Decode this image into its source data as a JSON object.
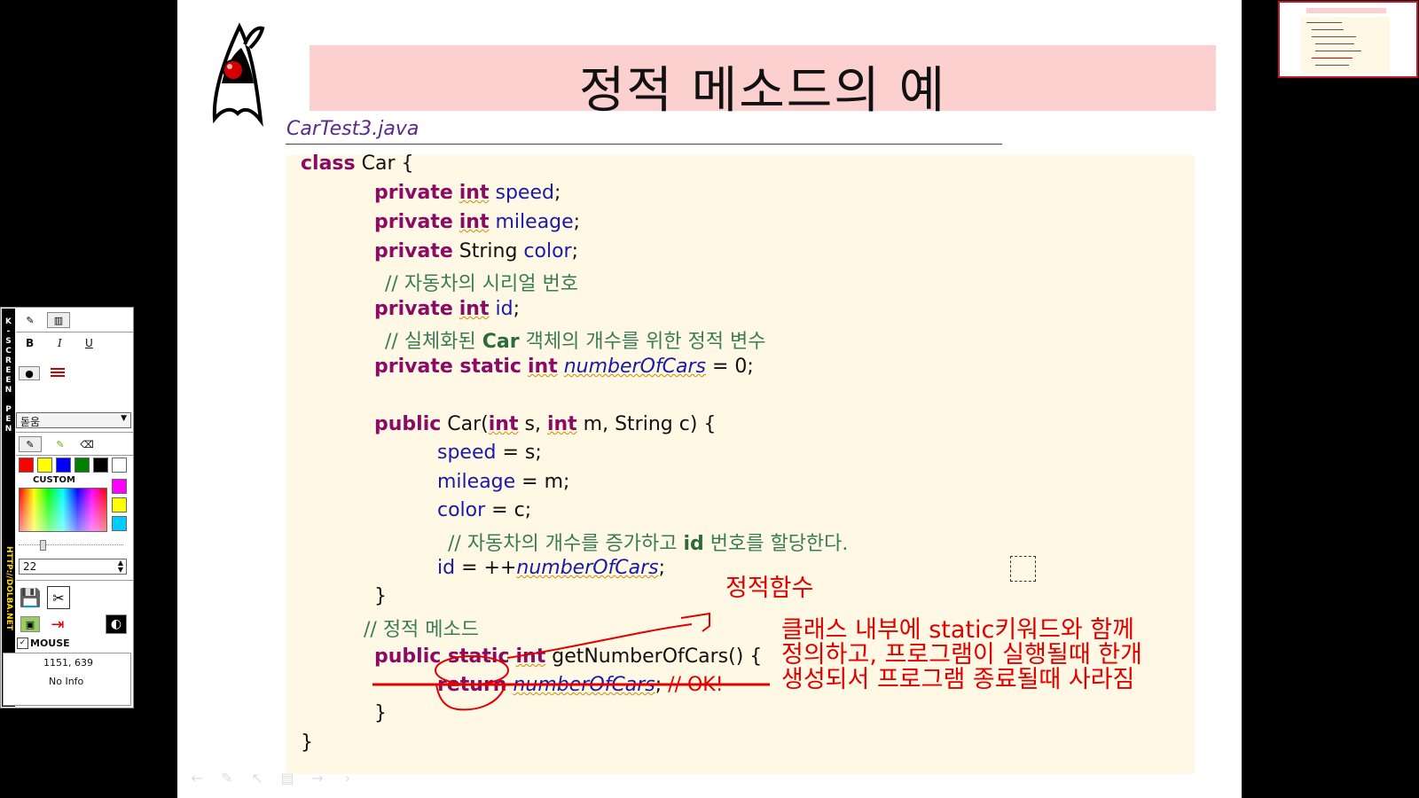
{
  "slide": {
    "title": "정적 메소드의 예",
    "filename": "CarTest3.java",
    "code": {
      "l1": {
        "kw": "class",
        "name": " Car {"
      },
      "l2": {
        "kw": "private",
        "type": "int",
        "var": "speed",
        "end": ";"
      },
      "l3": {
        "kw": "private",
        "type": "int",
        "var": "mileage",
        "end": ";"
      },
      "l4": {
        "kw": "private",
        "type": "String",
        "var": "color",
        "end": ";"
      },
      "l5": {
        "comment": "// 자동차의 시리얼 번호"
      },
      "l6": {
        "kw": "private",
        "type": "int",
        "var": "id",
        "end": ";"
      },
      "l7": {
        "c1": "// 실체화된 ",
        "c2": "Car",
        "c3": " 객체의 개수를 위한 정적 변수"
      },
      "l8": {
        "kw": "private static",
        "type": "int",
        "var": "numberOfCars",
        "end": " = 0;"
      },
      "l9": {
        "kw": "public",
        "a": " Car(",
        "t1": "int",
        "b": " s, ",
        "t2": "int",
        "c": " m, String c) {"
      },
      "l10": {
        "var": "speed",
        "end": " = s;"
      },
      "l11": {
        "var": "mileage",
        "end": " = m;"
      },
      "l12": {
        "var": "color",
        "end": " = c;"
      },
      "l13": {
        "c1": "// 자동차의 개수를 증가하고 ",
        "c2": "id",
        "c3": " 번호를 할당한다."
      },
      "l14": {
        "var": "id",
        "mid": " = ++",
        "var2": "numberOfCars",
        "end": ";"
      },
      "l15": {
        "text": "}"
      },
      "l16": {
        "comment": "// 정적 메소드"
      },
      "l17": {
        "kw": "public static",
        "type": "int",
        "rest": " getNumberOfCars() {"
      },
      "l18": {
        "kw": "return",
        "var": "numberOfCars",
        "end": "; ",
        "ok": "// OK!"
      },
      "l19": {
        "text": "}"
      },
      "l20": {
        "text": "}"
      }
    },
    "annotations": {
      "label": "정적함수",
      "note_l1": "클래스 내부에 static키워드와 함께",
      "note_l2": "정의하고, 프로그램이 실행될때 한개",
      "note_l3": "생성되서 프로그램 종료될때 사라짐",
      "color": "#e10000"
    },
    "nav": [
      "←",
      "✎",
      "↖",
      "▤",
      "→",
      "›"
    ]
  },
  "pen_toolbar": {
    "side_label": [
      "K",
      "-",
      "S",
      "C",
      "R",
      "E",
      "E",
      "N",
      "",
      "P",
      "E",
      "N"
    ],
    "side_url": "HTTP://DOLBA.NET",
    "bold": "B",
    "italic": "I",
    "underline": "U",
    "font": "돋움",
    "custom_label": "CUSTOM",
    "size_value": "22",
    "mouse_label": "MOUSE",
    "mouse_checked": true,
    "coords": "1151, 639",
    "info": "No Info",
    "colors": [
      "#ff0000",
      "#ffff00",
      "#0000ff",
      "#008000",
      "#000000",
      "#ffffff"
    ],
    "custom_colors": [
      "#ff00ff",
      "#ffff00",
      "#00ccff"
    ]
  }
}
